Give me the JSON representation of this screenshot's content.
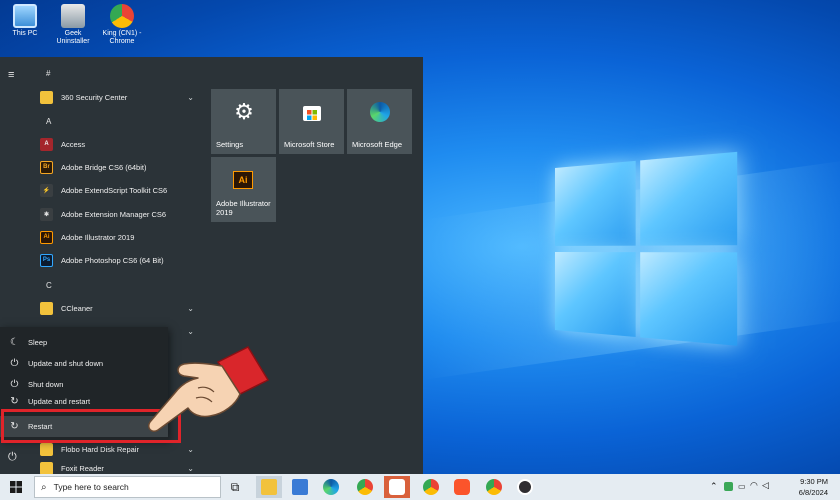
{
  "desktop": {
    "icons": [
      {
        "label": "This PC"
      },
      {
        "label": "Geek Uninstaller"
      },
      {
        "label": "King (CN1) - Chrome"
      }
    ]
  },
  "start_menu": {
    "groups": [
      {
        "letter": "#"
      },
      {
        "letter": "A"
      },
      {
        "letter": "C"
      }
    ],
    "apps": [
      {
        "label": "360 Security Center",
        "icon": "folder-icon",
        "expandable": true
      },
      {
        "label": "Access",
        "icon": "access-icon",
        "badge": "A"
      },
      {
        "label": "Adobe Bridge CS6 (64bit)",
        "icon": "bridge-icon",
        "badge": "Br"
      },
      {
        "label": "Adobe ExtendScript Toolkit CS6",
        "icon": "extendscript-icon"
      },
      {
        "label": "Adobe Extension Manager CS6",
        "icon": "extension-manager-icon"
      },
      {
        "label": "Adobe Illustrator 2019",
        "icon": "illustrator-icon",
        "badge": "Ai"
      },
      {
        "label": "Adobe Photoshop CS6 (64 Bit)",
        "icon": "photoshop-icon",
        "badge": "Ps"
      },
      {
        "label": "CCleaner",
        "icon": "folder-icon",
        "expandable": true
      },
      {
        "label": "Flobo Hard Disk Repair",
        "icon": "folder-icon",
        "expandable": true
      },
      {
        "label": "Foxit Reader",
        "icon": "folder-icon",
        "expandable": true
      }
    ],
    "tiles": [
      {
        "label": "Settings",
        "icon": "gear-icon"
      },
      {
        "label": "Microsoft Store",
        "icon": "store-icon"
      },
      {
        "label": "Microsoft Edge",
        "icon": "edge-icon"
      },
      {
        "label": "Adobe Illustrator 2019",
        "icon": "illustrator-icon",
        "badge": "Ai"
      }
    ]
  },
  "power_menu": {
    "items": [
      {
        "label": "Sleep",
        "icon": "moon-icon"
      },
      {
        "label": "Update and shut down",
        "icon": "update-power-icon"
      },
      {
        "label": "Shut down",
        "icon": "power-icon"
      },
      {
        "label": "Update and restart",
        "icon": "update-restart-icon"
      },
      {
        "label": "Restart",
        "icon": "restart-icon",
        "selected": true
      }
    ]
  },
  "taskbar": {
    "search_placeholder": "Type here to search",
    "apps": [
      "task-view-icon",
      "file-explorer-icon",
      "photos-icon",
      "edge-icon",
      "chrome-icon",
      "app-icon",
      "chrome-icon",
      "brave-icon",
      "chrome-icon",
      "obs-icon"
    ],
    "clock": {
      "time": "9:30 PM",
      "date": "6/8/2024"
    }
  },
  "colors": {
    "highlight": "#e0242a",
    "start_bg": "#2b3338",
    "tile_bg": "#4a5459"
  }
}
